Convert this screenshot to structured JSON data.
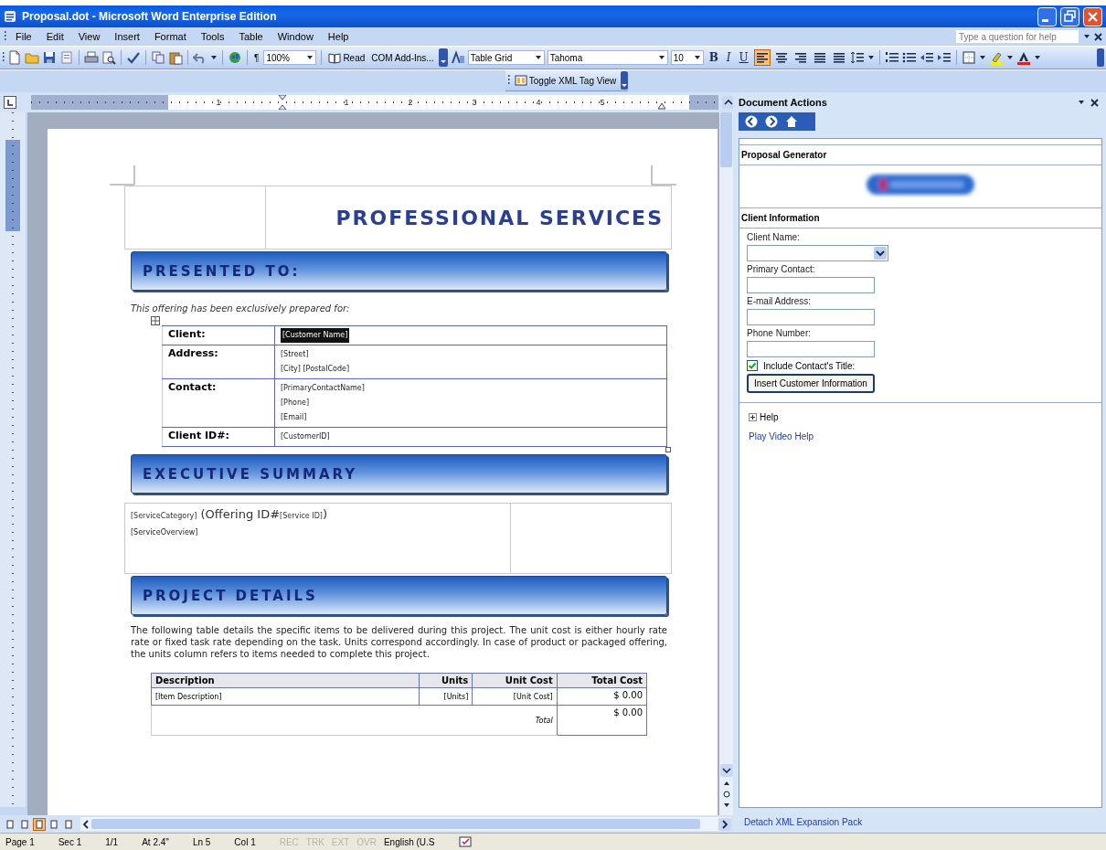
{
  "window": {
    "title": "Proposal.dot - Microsoft Word Enterprise Edition"
  },
  "menu": [
    "File",
    "Edit",
    "View",
    "Insert",
    "Format",
    "Tools",
    "Table",
    "Window",
    "Help"
  ],
  "help_search": {
    "placeholder": "Type a question for help"
  },
  "toolbar": {
    "pilcrow": "¶",
    "zoom": "100%",
    "read": "Read",
    "com_add_ins": "COM Add-Ins...",
    "style": "Table Grid",
    "font": "Tahoma",
    "size": "10",
    "format_buttons": [
      {
        "label": "B"
      },
      {
        "label": "I"
      },
      {
        "label": "U"
      }
    ],
    "alignment": [
      {
        "selected": true
      },
      {
        "selected": false
      },
      {
        "selected": false
      },
      {
        "selected": false
      },
      {
        "selected": false
      }
    ]
  },
  "xml_toolbar": {
    "button": "Toggle XML Tag View"
  },
  "ruler": {
    "numbers": [
      "1",
      "1",
      "2",
      "3",
      "4",
      "5"
    ]
  },
  "document": {
    "title": "PROFESSIONAL SERVICES",
    "presented_to": {
      "heading": "PRESENTED TO:",
      "intro": "This offering has been exclusively prepared for:",
      "rows": [
        {
          "label": "Client:",
          "values": [
            {
              "text": "[Customer Name]",
              "selected": true
            }
          ]
        },
        {
          "label": "Address:",
          "values": [
            {
              "text": "[Street]",
              "selected": false
            },
            {
              "text": "[City] [PostalCode]",
              "selected": false
            }
          ]
        },
        {
          "label": "Contact:",
          "values": [
            {
              "text": "[PrimaryContactName]",
              "selected": false
            },
            {
              "text": "[Phone]",
              "selected": false
            },
            {
              "text": "[Email]",
              "selected": false
            }
          ]
        },
        {
          "label": "Client ID#:",
          "values": [
            {
              "text": "[CustomerID]",
              "selected": false
            }
          ]
        }
      ]
    },
    "executive_summary": {
      "heading": "EXECUTIVE SUMMARY",
      "offering_line": [
        {
          "kind": "tag",
          "text": "[ServiceCategory]"
        },
        {
          "kind": "text",
          "text": " (Offering ID#"
        },
        {
          "kind": "tag",
          "text": "[Service ID]"
        },
        {
          "kind": "text",
          "text": ")"
        }
      ],
      "overview": "[ServiceOverview]"
    },
    "project_details": {
      "heading": "PROJECT DETAILS",
      "paragraph": "The following table details the specific items to be delivered during this project. The unit cost is either hourly rate rate or fixed task rate depending on the task. Units correspond accordingly. In case of product or packaged offering, the units column refers to items needed to complete this project.",
      "table": {
        "columns": [
          "Description",
          "Units",
          "Unit Cost",
          "Total Cost"
        ],
        "rows": [
          [
            "[Item Description]",
            "[Units]",
            "[Unit Cost]",
            "$ 0.00"
          ]
        ],
        "total_label": "Total",
        "total": "$ 0.00"
      }
    }
  },
  "view_buttons": [
    {
      "selected": false
    },
    {
      "selected": false
    },
    {
      "selected": true
    },
    {
      "selected": false
    },
    {
      "selected": false
    }
  ],
  "task_pane": {
    "title": "Document Actions",
    "heading": "Proposal Generator",
    "section": "Client Information",
    "fields": [
      {
        "kind": "dropdown",
        "label": "Client Name:"
      },
      {
        "kind": "text",
        "label": "Primary Contact:"
      },
      {
        "kind": "text",
        "label": "E-mail Address:"
      },
      {
        "kind": "text",
        "label": "Phone Number:"
      }
    ],
    "checkbox": {
      "label": "Include Contact's Title:",
      "checked": true
    },
    "button": "Insert Customer Information",
    "help": {
      "label": "Help",
      "expanded": false
    },
    "video_link": "Play Video Help",
    "detach_link": "Detach XML Expansion Pack"
  },
  "status_bar": [
    {
      "text": "Page 1",
      "disabled": false
    },
    {
      "text": "Sec 1",
      "disabled": false
    },
    {
      "text": "1/1",
      "disabled": false
    },
    {
      "text": "At 2.4\"",
      "disabled": false
    },
    {
      "text": "Ln 5",
      "disabled": false
    },
    {
      "text": "Col 1",
      "disabled": false
    },
    {
      "text": "REC",
      "disabled": true
    },
    {
      "text": "TRK",
      "disabled": true
    },
    {
      "text": "EXT",
      "disabled": true
    },
    {
      "text": "OVR",
      "disabled": true
    },
    {
      "text": "English (U.S",
      "disabled": false
    }
  ]
}
